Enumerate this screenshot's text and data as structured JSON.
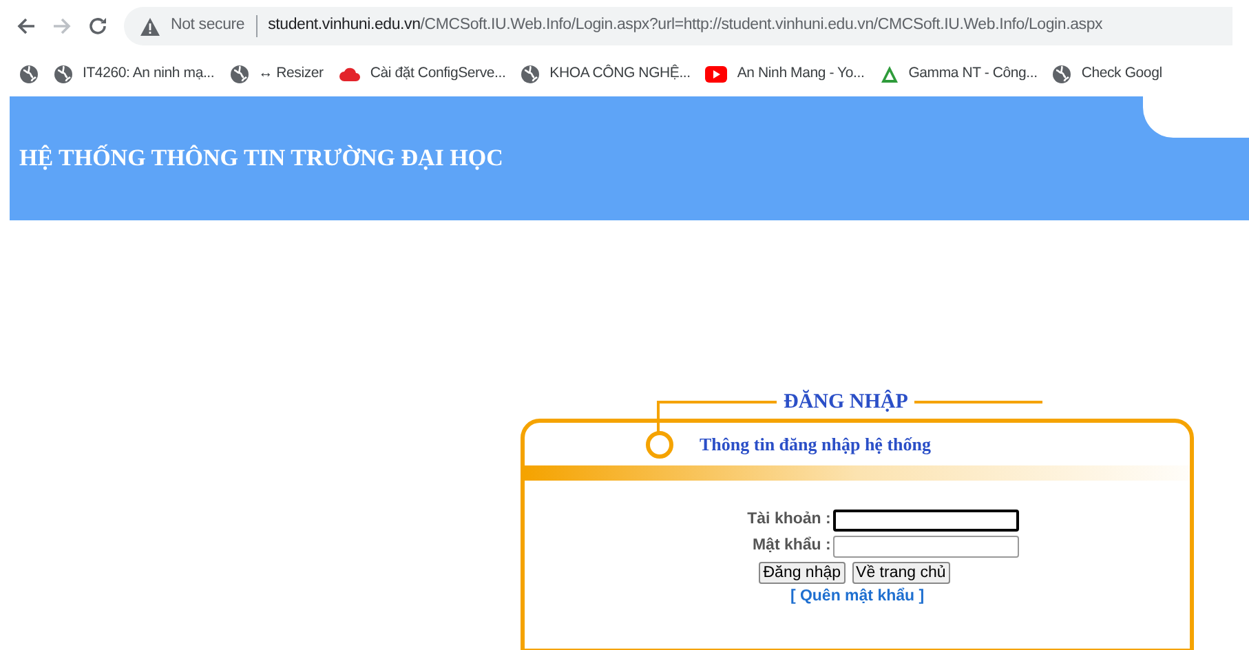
{
  "browser": {
    "security": "Not secure",
    "url_host": "student.vinhuni.edu.vn",
    "url_rest": "/CMCSoft.IU.Web.Info/Login.aspx?url=http://student.vinhuni.edu.vn/CMCSoft.IU.Web.Info/Login.aspx",
    "bookmarks": [
      {
        "kind": "globe"
      },
      {
        "kind": "globe",
        "label": "IT4260: An ninh mạ..."
      },
      {
        "kind": "globe",
        "label": "↔ Resizer"
      },
      {
        "kind": "cloud",
        "label": "Cài đặt ConfigServe..."
      },
      {
        "kind": "globe",
        "label": "KHOA CÔNG NGHỆ..."
      },
      {
        "kind": "video",
        "label": "An Ninh Mang - Yo..."
      },
      {
        "kind": "triangle",
        "label": "Gamma NT - Công..."
      },
      {
        "kind": "globe",
        "label": "Check Googl"
      }
    ]
  },
  "header": {
    "title": "HỆ THỐNG THÔNG TIN TRƯỜNG ĐẠI HỌC"
  },
  "login": {
    "title": "ĐĂNG NHẬP",
    "subtitle": "Thông tin đăng nhập hệ thống",
    "fields": [
      {
        "label": "Tài khoản :",
        "focused": true
      },
      {
        "label": "Mật khẩu :",
        "focused": false
      }
    ],
    "buttons": [
      "Đăng nhập",
      "Về trang chủ"
    ],
    "link": "[ Quên mật khẩu ]"
  }
}
